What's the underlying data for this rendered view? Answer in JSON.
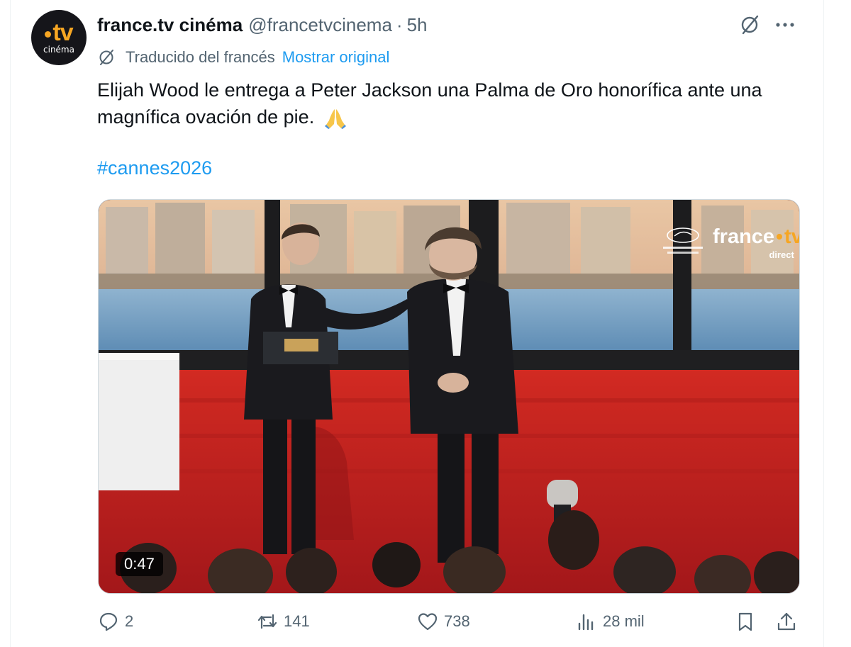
{
  "author": {
    "display_name": "france.tv cinéma",
    "handle": "@francetvcinema",
    "separator": "·",
    "time_ago": "5h",
    "avatar_logo_text": "tv",
    "avatar_sub_text": "cinéma"
  },
  "translation": {
    "label": "Traducido del francés",
    "show_original": "Mostrar original"
  },
  "tweet": {
    "text": "Elijah Wood le entrega a Peter Jackson una Palma de Oro honorífica ante una magnífica ovación de pie.",
    "emoji": "folded-hands",
    "hashtag": "#cannes2026"
  },
  "media": {
    "duration": "0:47",
    "watermark_brand": "france",
    "watermark_brand_suffix": "tv",
    "watermark_sub": "direct"
  },
  "actions": {
    "replies": "2",
    "reposts": "141",
    "likes": "738",
    "views": "28 mil"
  },
  "colors": {
    "link": "#1d9bf0",
    "muted": "#536471",
    "text": "#0f1419",
    "brand_accent": "#f6a623"
  }
}
